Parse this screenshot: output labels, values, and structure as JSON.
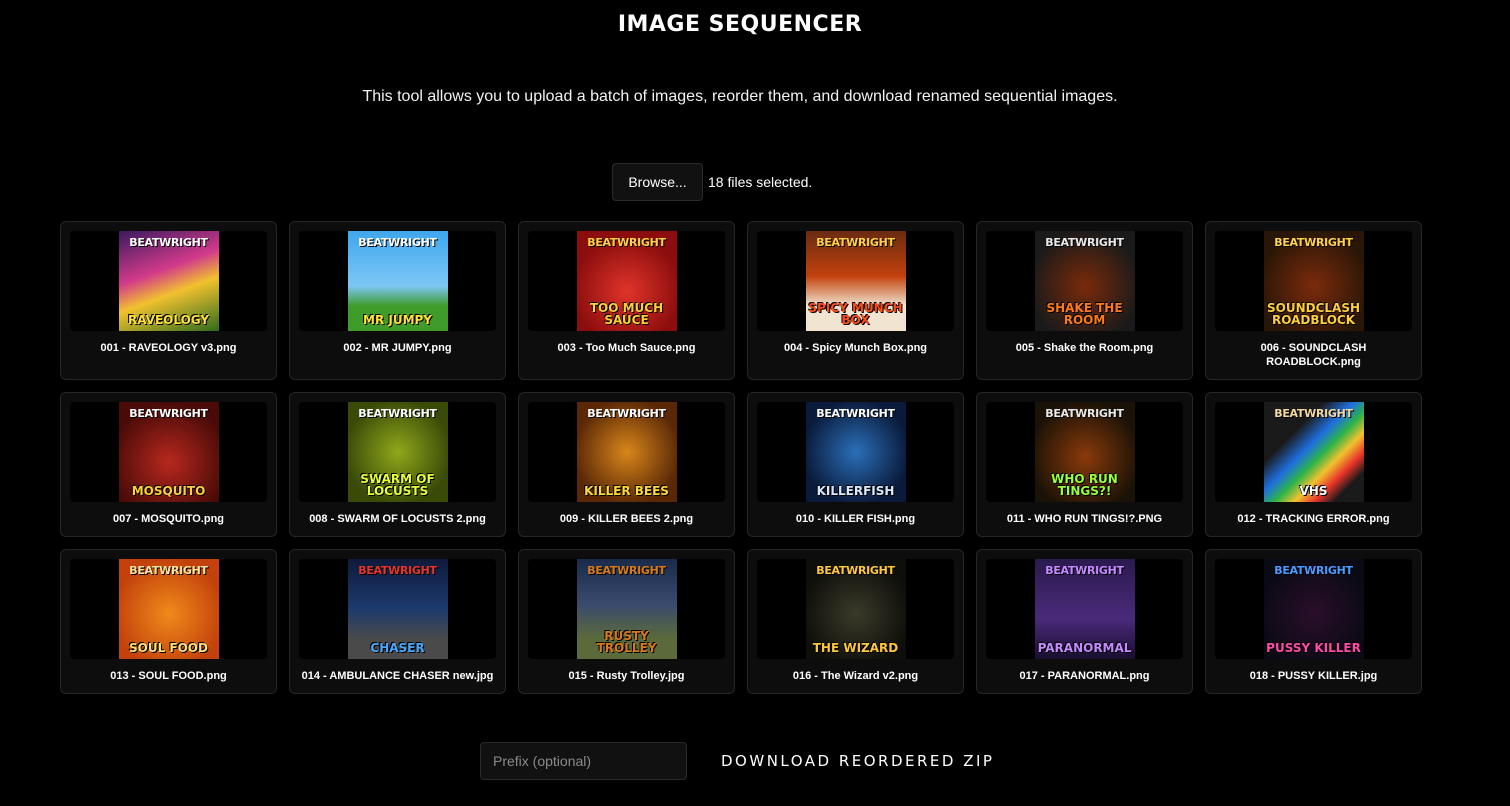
{
  "title": "IMAGE SEQUENCER",
  "description": "This tool allows you to upload a batch of images, reorder them, and download renamed sequential images.",
  "upload": {
    "browse_label": "Browse...",
    "status": "18 files selected."
  },
  "images": [
    {
      "filename": "001 - RAVEOLOGY v3.png",
      "brand": "BEATWRIGHT",
      "art_text": "RAVEOLOGY",
      "bg": "linear-gradient(160deg,#3a1a5e,#d23a8a 40%,#f2c12e 60%,#2f6b1d)",
      "brand_color": "#ffffff",
      "art_color": "#ffe23d"
    },
    {
      "filename": "002 - MR JUMPY.png",
      "brand": "BEATWRIGHT",
      "art_text": "MR JUMPY",
      "bg": "linear-gradient(180deg,#3fa7ee 0%,#7cc7f5 55%,#3f9b2a 75%)",
      "brand_color": "#ffffff",
      "art_color": "#ffe23d"
    },
    {
      "filename": "003 - Too Much Sauce.png",
      "brand": "BEATWRIGHT",
      "art_text": "TOO MUCH SAUCE",
      "bg": "radial-gradient(circle at 50% 60%,#e0342a,#8b0d0d 70%)",
      "brand_color": "#ffd24a",
      "art_color": "#ffcf3a"
    },
    {
      "filename": "004 - Spicy Munch Box.png",
      "brand": "BEATWRIGHT",
      "art_text": "SPICY MUNCH BOX",
      "bg": "linear-gradient(180deg,#6a2b12,#c2410c 45%,#f1e4d0 75%)",
      "brand_color": "#ffd24a",
      "art_color": "#ff4d1a"
    },
    {
      "filename": "005 - Shake the Room.png",
      "brand": "BEATWRIGHT",
      "art_text": "SHAKE THE ROOM",
      "bg": "radial-gradient(circle at 50% 55%,#7a2a0a,#1a1a1a 75%)",
      "brand_color": "#e8e8e8",
      "art_color": "#ff7a1a"
    },
    {
      "filename": "006 - SOUNDCLASH ROADBLOCK.png",
      "brand": "BEATWRIGHT",
      "art_text": "SOUNDCLASH ROADBLOCK",
      "bg": "radial-gradient(circle at 50% 55%,#7b2b0c,#2a1606 75%)",
      "brand_color": "#ffd24a",
      "art_color": "#ffcf3a"
    },
    {
      "filename": "007 - MOSQUITO.png",
      "brand": "BEATWRIGHT",
      "art_text": "MOSQUITO",
      "bg": "radial-gradient(circle at 50% 60%,#b8281e,#4a0b08 75%)",
      "brand_color": "#ffffff",
      "art_color": "#ffcf3a"
    },
    {
      "filename": "008 - SWARM OF LOCUSTS 2.png",
      "brand": "BEATWRIGHT",
      "art_text": "SWARM OF LOCUSTS",
      "bg": "radial-gradient(circle at 50% 50%,#8fa81a,#3a4a08 75%)",
      "brand_color": "#ffffff",
      "art_color": "#e8ff3a"
    },
    {
      "filename": "009 - KILLER BEES 2.png",
      "brand": "BEATWRIGHT",
      "art_text": "KILLER BEES",
      "bg": "radial-gradient(circle at 50% 50%,#d9861a,#5a2806 75%)",
      "brand_color": "#ffffff",
      "art_color": "#ffd83a"
    },
    {
      "filename": "010 - KILLER FISH.png",
      "brand": "BEATWRIGHT",
      "art_text": "KILLERFISH",
      "bg": "radial-gradient(circle at 50% 50%,#2a6fb8,#0a1a3a 75%)",
      "brand_color": "#ffffff",
      "art_color": "#dbe9ff"
    },
    {
      "filename": "011 - WHO RUN TINGS!?.PNG",
      "brand": "BEATWRIGHT",
      "art_text": "WHO RUN TINGS?!",
      "bg": "radial-gradient(circle at 50% 55%,#8a3a0a,#1a1206 75%)",
      "brand_color": "#e8e8e8",
      "art_color": "#9bff3a"
    },
    {
      "filename": "012 - TRACKING ERROR.png",
      "brand": "BEATWRIGHT",
      "art_text": "VHS",
      "bg": "linear-gradient(135deg,#1a1a1a 30%,#1f6fe0 45%,#2bb34a 55%,#f2c12e 65%,#e8342a 75%,#1a1a1a 85%)",
      "brand_color": "#f3d9a0",
      "art_color": "#ffffff"
    },
    {
      "filename": "013 - SOUL FOOD.png",
      "brand": "BEATWRIGHT",
      "art_text": "SOUL FOOD",
      "bg": "radial-gradient(circle at 50% 55%,#f08a1a,#c2410c 75%)",
      "brand_color": "#ffe3a0",
      "art_color": "#ffe07a"
    },
    {
      "filename": "014 - AMBULANCE CHASER new.jpg",
      "brand": "BEATWRIGHT",
      "art_text": "CHASER",
      "bg": "linear-gradient(180deg,#0e1a3a 0%,#1d3a6e 50%,#4a4a4a 80%)",
      "brand_color": "#e8342a",
      "art_color": "#4aa8ff"
    },
    {
      "filename": "015 - Rusty Trolley.jpg",
      "brand": "BEATWRIGHT",
      "art_text": "RUSTY TROLLEY",
      "bg": "linear-gradient(180deg,#1a2a4a 0%,#3a4a6e 45%,#5a6a3a 80%)",
      "brand_color": "#d97a1a",
      "art_color": "#d97a1a"
    },
    {
      "filename": "016 - The Wizard v2.png",
      "brand": "BEATWRIGHT",
      "art_text": "THE WIZARD",
      "bg": "radial-gradient(circle at 50% 55%,#3a3a2a,#0e0e0a 75%)",
      "brand_color": "#ffc83a",
      "art_color": "#ffc83a"
    },
    {
      "filename": "017 - PARANORMAL.png",
      "brand": "BEATWRIGHT",
      "art_text": "PARANORMAL",
      "bg": "linear-gradient(180deg,#2a1a4e 0%,#4a2a7a 60%,#1a0e2e 100%)",
      "brand_color": "#c48aff",
      "art_color": "#c48aff"
    },
    {
      "filename": "018 - PUSSY KILLER.jpg",
      "brand": "BEATWRIGHT",
      "art_text": "Pussy Killer",
      "bg": "radial-gradient(circle at 50% 55%,#2a0e2a,#0a0a14 75%)",
      "brand_color": "#4a9bff",
      "art_color": "#ff4aa8"
    }
  ],
  "footer": {
    "prefix_placeholder": "Prefix (optional)",
    "download_label": "DOWNLOAD REORDERED ZIP"
  }
}
